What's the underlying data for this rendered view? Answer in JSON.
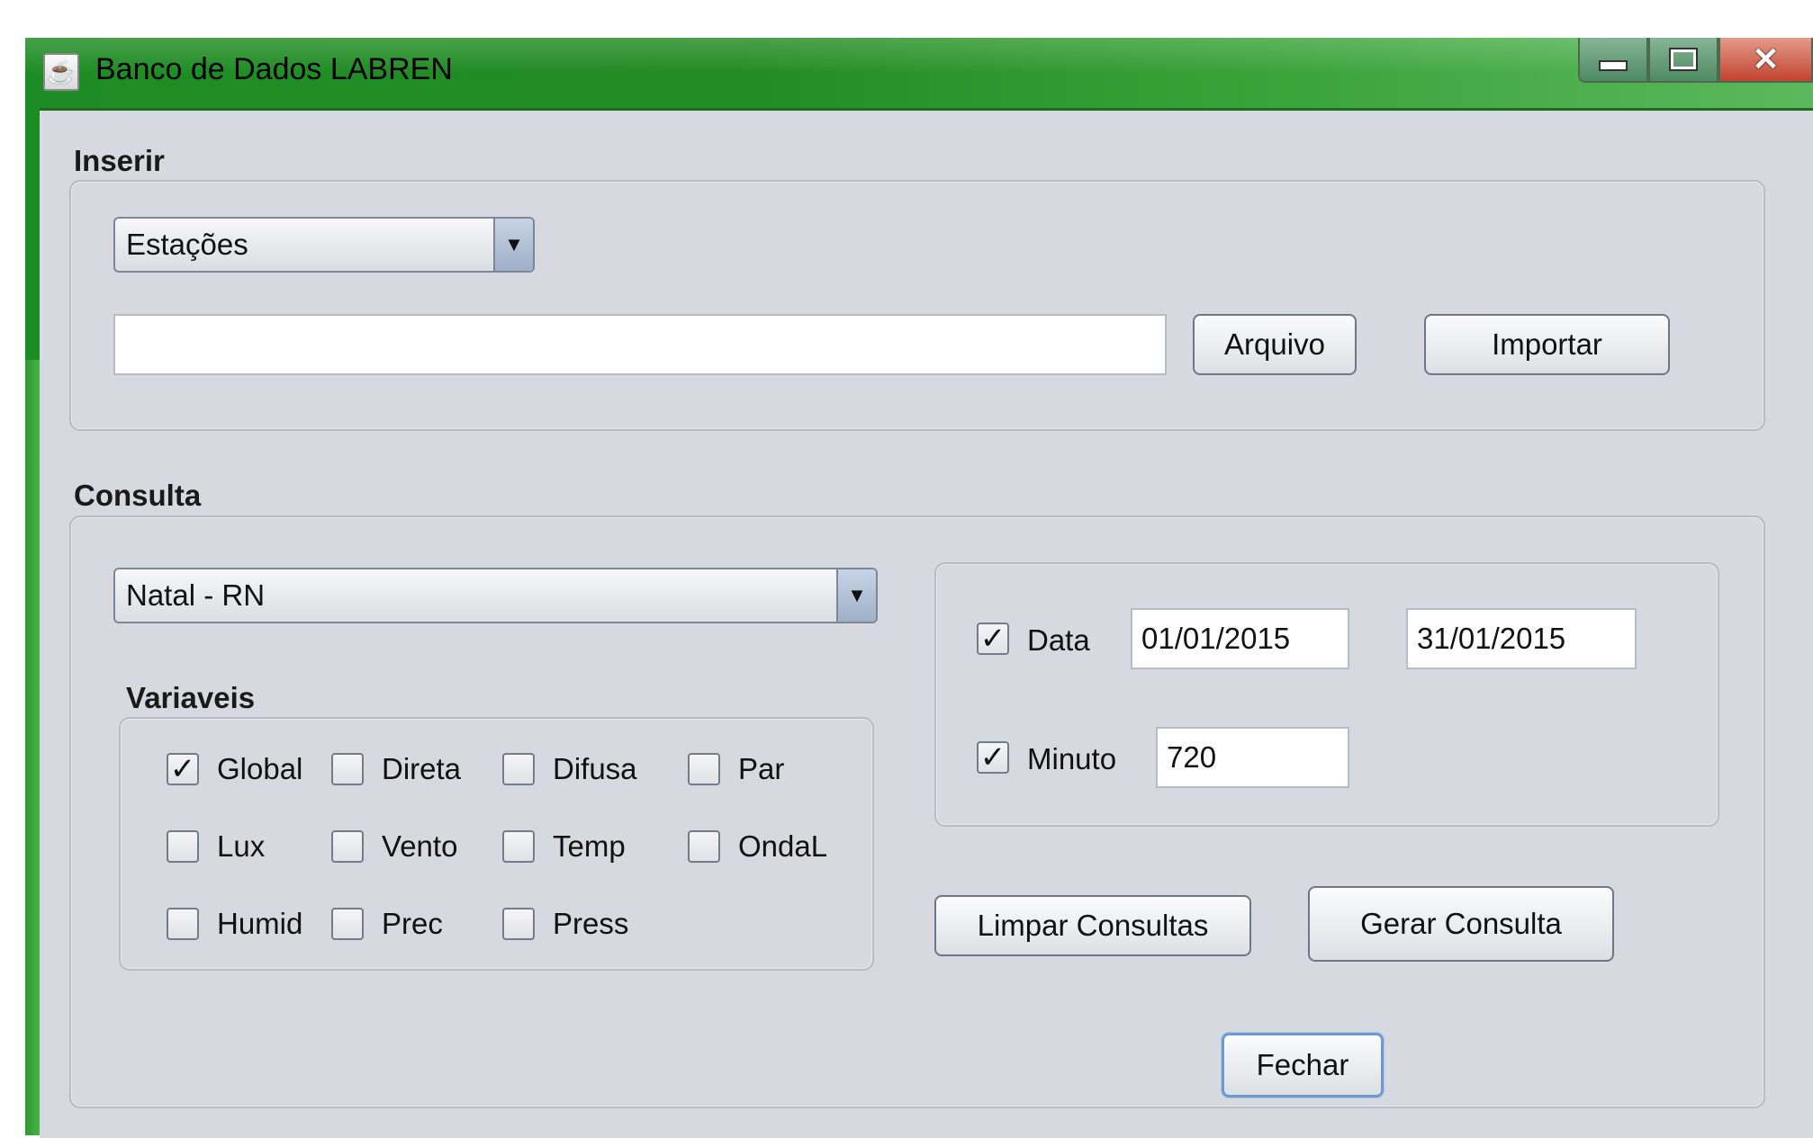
{
  "window": {
    "title": "Banco de Dados LABREN",
    "accent_color": "#1e8c24",
    "controls": {
      "minimize_icon": "minimize-icon",
      "maximize_icon": "maximize-icon",
      "close_icon": "close-icon"
    }
  },
  "inserir": {
    "title": "Inserir",
    "combo_value": "Estações",
    "file_path_value": "",
    "arquivo_label": "Arquivo",
    "importar_label": "Importar"
  },
  "consulta": {
    "title": "Consulta",
    "station_value": "Natal - RN",
    "variaveis_title": "Variaveis",
    "variables": [
      {
        "label": "Global",
        "checked": true
      },
      {
        "label": "Direta",
        "checked": false
      },
      {
        "label": "Difusa",
        "checked": false
      },
      {
        "label": "Par",
        "checked": false
      },
      {
        "label": "Lux",
        "checked": false
      },
      {
        "label": "Vento",
        "checked": false
      },
      {
        "label": "Temp",
        "checked": false
      },
      {
        "label": "OndaL",
        "checked": false
      },
      {
        "label": "Humid",
        "checked": false
      },
      {
        "label": "Prec",
        "checked": false
      },
      {
        "label": "Press",
        "checked": false
      }
    ],
    "data_label": "Data",
    "data_checked": true,
    "data_start": "01/01/2015",
    "data_end": "31/01/2015",
    "minuto_label": "Minuto",
    "minuto_checked": true,
    "minuto_value": "720",
    "limpar_label": "Limpar Consultas",
    "gerar_label": "Gerar Consulta",
    "fechar_label": "Fechar"
  }
}
